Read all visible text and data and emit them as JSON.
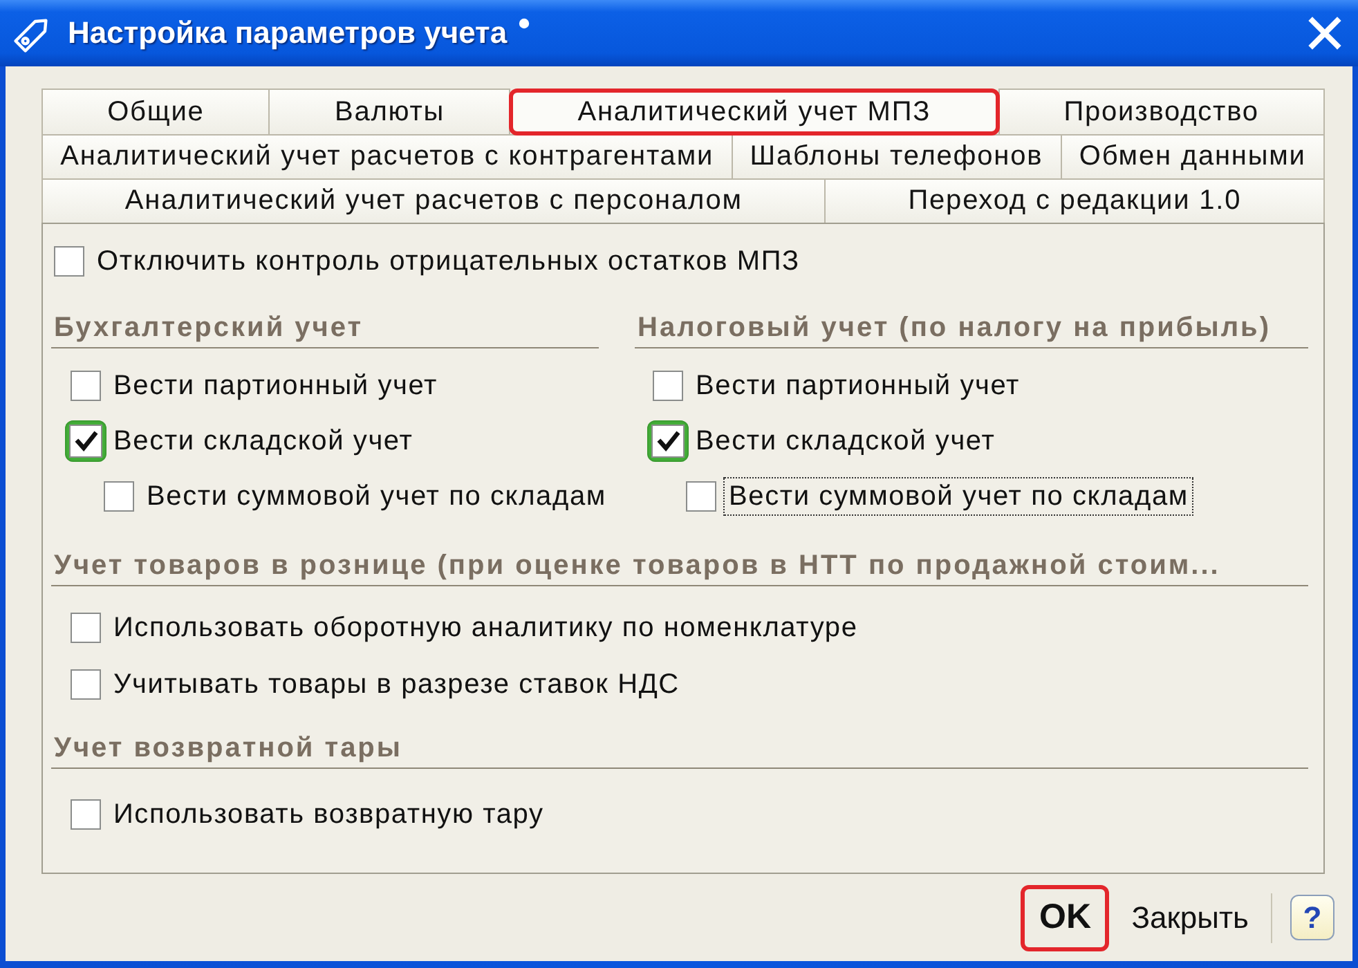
{
  "window": {
    "title": "Настройка параметров учета",
    "modified": true
  },
  "tab_rows": [
    {
      "tabs": [
        {
          "label": "Общие",
          "selected": false,
          "highlighted": false
        },
        {
          "label": "Валюты",
          "selected": false,
          "highlighted": false
        },
        {
          "label": "Аналитический учет МПЗ",
          "selected": true,
          "highlighted": true
        },
        {
          "label": "Производство",
          "selected": false,
          "highlighted": false
        }
      ]
    },
    {
      "tabs": [
        {
          "label": "Аналитический учет расчетов с контрагентами",
          "selected": false,
          "highlighted": false
        },
        {
          "label": "Шаблоны телефонов",
          "selected": false,
          "highlighted": false
        },
        {
          "label": "Обмен данными",
          "selected": false,
          "highlighted": false
        }
      ]
    },
    {
      "tabs": [
        {
          "label": "Аналитический учет расчетов с персоналом",
          "selected": false,
          "highlighted": false
        },
        {
          "label": "Переход с редакции 1.0",
          "selected": false,
          "highlighted": false
        }
      ]
    }
  ],
  "panel": {
    "top_options": [
      {
        "label": "Отключить контроль отрицательных остатков МПЗ",
        "checked": false,
        "highlighted": false,
        "focused": false
      }
    ],
    "columns": [
      {
        "heading": "Бухгалтерский учет",
        "options": [
          {
            "label": "Вести партионный учет",
            "checked": false,
            "highlighted": false,
            "focused": false
          },
          {
            "label": "Вести складской учет",
            "checked": true,
            "highlighted": true,
            "focused": false,
            "children": [
              {
                "label": "Вести суммовой учет по складам",
                "checked": false,
                "highlighted": false,
                "focused": false
              }
            ]
          }
        ]
      },
      {
        "heading": "Налоговый учет (по налогу на прибыль)",
        "options": [
          {
            "label": "Вести партионный учет",
            "checked": false,
            "highlighted": false,
            "focused": false
          },
          {
            "label": "Вести складской учет",
            "checked": true,
            "highlighted": true,
            "focused": false,
            "children": [
              {
                "label": "Вести суммовой учет по складам",
                "checked": false,
                "highlighted": false,
                "focused": true
              }
            ]
          }
        ]
      }
    ],
    "sections": [
      {
        "heading": "Учет товаров в рознице (при оценке товаров в НТТ по продажной стоим...",
        "options": [
          {
            "label": "Использовать оборотную аналитику по номенклатуре",
            "checked": false,
            "highlighted": false,
            "focused": false
          },
          {
            "label": "Учитывать товары в разрезе ставок НДС",
            "checked": false,
            "highlighted": false,
            "focused": false
          }
        ]
      },
      {
        "heading": "Учет возвратной тары",
        "options": [
          {
            "label": "Использовать возвратную тару",
            "checked": false,
            "highlighted": false,
            "focused": false
          }
        ]
      }
    ]
  },
  "buttons": [
    {
      "kind": "default",
      "label": "OK",
      "highlighted": true
    },
    {
      "kind": "plain",
      "label": "Закрыть",
      "highlighted": false
    },
    {
      "kind": "help",
      "label": "?",
      "highlighted": false
    }
  ]
}
